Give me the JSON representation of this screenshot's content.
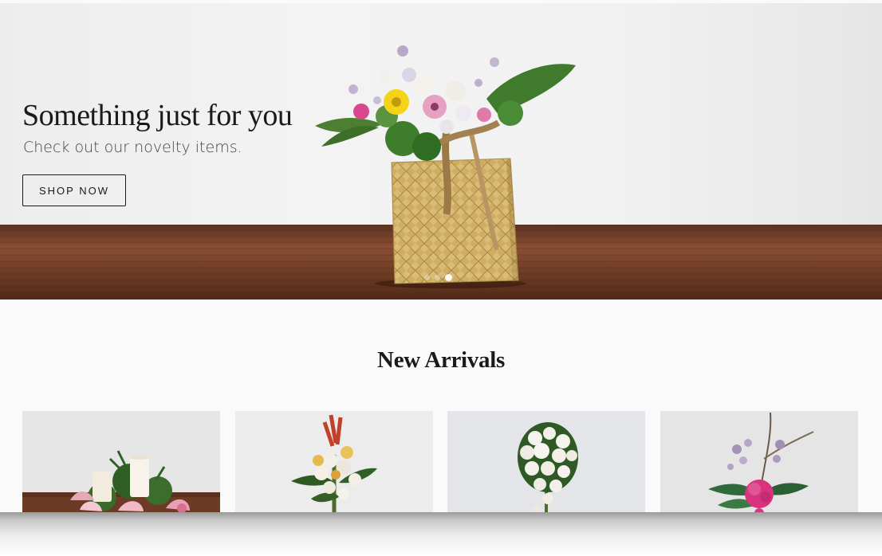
{
  "hero": {
    "title": "Something just for you",
    "subtitle": "Check out our novelty items.",
    "cta_label": "SHOP NOW",
    "slide_count": 3,
    "active_slide": 3,
    "product_icon": "woven-bag-bouquet"
  },
  "new_arrivals": {
    "title": "New Arrivals",
    "products": [
      {
        "image": "candle-lily-centerpiece"
      },
      {
        "image": "tropical-standing-spray"
      },
      {
        "image": "white-rose-standing-wreath"
      },
      {
        "image": "pink-carnation-ikebana"
      }
    ]
  },
  "colors": {
    "text_dark": "#1a1a1a",
    "text_muted": "#444444",
    "page_background": "#fafafa",
    "wood": "#7a4530",
    "basket": "#c9a75a"
  }
}
